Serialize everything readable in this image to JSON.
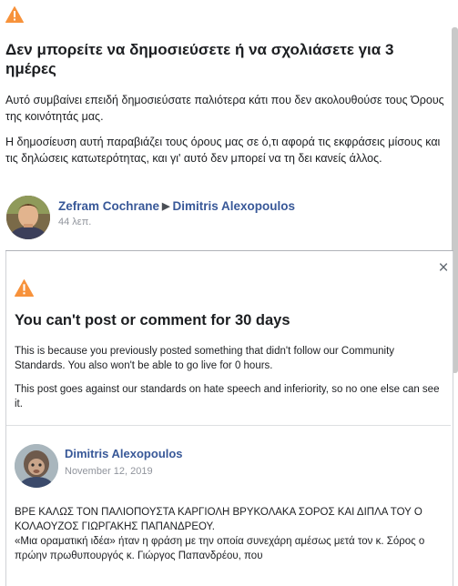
{
  "greek_notice": {
    "warning_icon": "warning-triangle-icon",
    "title": "Δεν μπορείτε να δημοσιεύσετε ή να σχολιάσετε για 3 ημέρες",
    "paragraph1": "Αυτό συμβαίνει επειδή δημοσιεύσατε παλιότερα κάτι που δεν ακολουθούσε τους Όρους της κοινότητάς μας.",
    "paragraph2": "Η δημοσίευση αυτή παραβιάζει τους όρους μας σε ό,τι αφορά τις εκφράσεις μίσους και τις δηλώσεις κατωτερότητας, και γι' αυτό δεν μπορεί να τη δει κανείς άλλος.",
    "author": "Zefram Cochrane",
    "arrow": "▶",
    "recipient": "Dimitris Alexopoulos",
    "time": "44 λεπ."
  },
  "english_notice": {
    "close_icon": "close-icon",
    "close_glyph": "×",
    "warning_icon": "warning-triangle-icon",
    "title": "You can't post or comment for 30 days",
    "paragraph1": "This is because you previously posted something that didn't follow our Community Standards. You also won't be able to go live for 0 hours.",
    "paragraph2": "This post goes against our standards on hate speech and inferiority, so no one else can see it.",
    "author": "Dimitris Alexopoulos",
    "date": "November 12, 2019",
    "post_line1": "ΒΡΕ ΚΑΛΩΣ ΤΟΝ ΠΑΛΙΟΠΟΥΣΤΑ ΚΑΡΓΙΟΛΗ ΒΡΥΚΟΛΑΚΑ ΣΟΡΟΣ ΚΑΙ ΔΙΠΛΑ ΤΟΥ Ο ΚΟΛΑΟΥΖΟΣ ΓΙΩΡΓΑΚΗΣ ΠΑΠΑΝΔΡΕΟΥ.",
    "post_line2": "«Μια οραματική ιδέα» ήταν η φράση με την οποία συνεχάρη αμέσως μετά τον κ. Σόρος ο πρώην πρωθυπουργός κ. Γιώργος Παπανδρέου, που"
  },
  "colors": {
    "link": "#385898",
    "warning": "#f7923b",
    "text": "#1c1e21",
    "muted": "#90949c"
  }
}
